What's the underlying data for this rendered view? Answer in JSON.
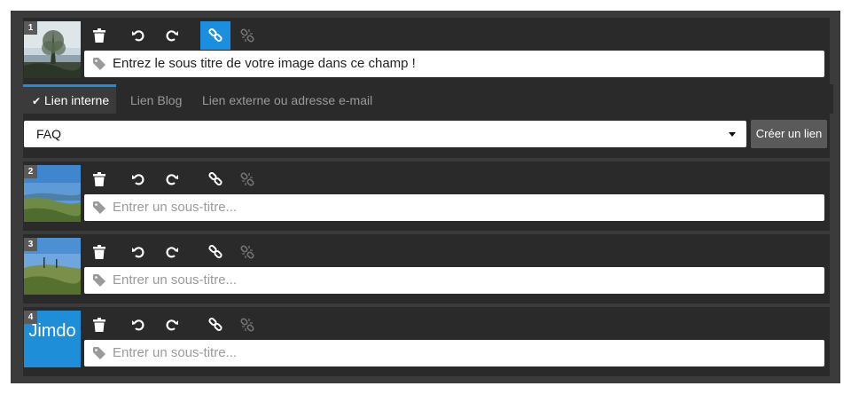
{
  "images": [
    {
      "number": "1",
      "caption": "Entrez le sous titre de votre image dans ce champ !",
      "caption_is_placeholder": false
    },
    {
      "number": "2",
      "caption": "Entrer un sous-titre...",
      "caption_is_placeholder": true
    },
    {
      "number": "3",
      "caption": "Entrer un sous-titre...",
      "caption_is_placeholder": true
    },
    {
      "number": "4",
      "caption": "Entrer un sous-titre...",
      "caption_is_placeholder": true,
      "logo_text": "Jimdo"
    }
  ],
  "link_panel": {
    "tabs": [
      "Lien interne",
      "Lien Blog",
      "Lien externe ou adresse e-mail"
    ],
    "active_tab": "Lien interne",
    "selected_page": "FAQ",
    "create_button": "Créer un lien"
  },
  "toolbar_icons": [
    "trash-icon",
    "undo-icon",
    "redo-icon",
    "link-icon",
    "unlink-icon"
  ],
  "colors": {
    "accent": "#1a8fe0",
    "panel": "#3b3b3b",
    "row": "#2a2a2a"
  }
}
